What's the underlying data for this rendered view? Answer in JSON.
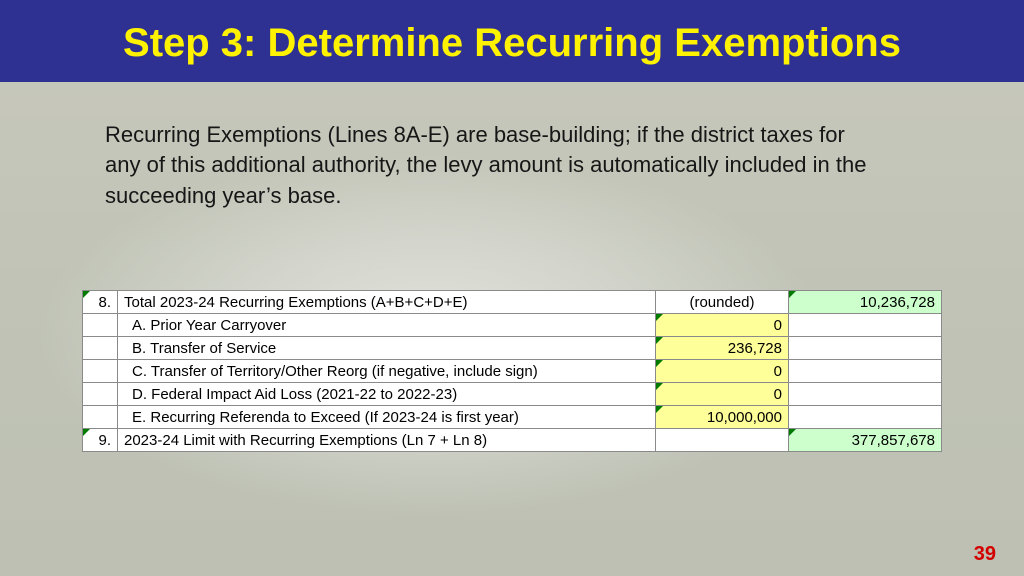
{
  "title": "Step 3: Determine Recurring Exemptions",
  "body": "Recurring Exemptions (Lines 8A-E) are base-building; if the district taxes for any of this additional authority, the levy amount is automatically included in the succeeding year’s base.",
  "page_number": "39",
  "table": {
    "rows": [
      {
        "lineno": "8.",
        "letter": "",
        "label": "Total 2023-24 Recurring Exemptions (A+B+C+D+E)",
        "col2": "(rounded)",
        "col3": "10,236,728",
        "col2_class": "rounded-note",
        "col3_class": "bg-green mark-tl"
      },
      {
        "lineno": "",
        "letter": "A.",
        "label": "Prior Year Carryover",
        "col2": "0",
        "col3": "",
        "col2_class": "bg-yellow mark-tl",
        "col3_class": ""
      },
      {
        "lineno": "",
        "letter": "B.",
        "label": "Transfer of Service",
        "col2": "236,728",
        "col3": "",
        "col2_class": "bg-yellow mark-tl",
        "col3_class": ""
      },
      {
        "lineno": "",
        "letter": "C.",
        "label": "Transfer of Territory/Other Reorg (if negative, include sign)",
        "col2": "0",
        "col3": "",
        "col2_class": "bg-yellow mark-tl",
        "col3_class": ""
      },
      {
        "lineno": "",
        "letter": "D.",
        "label": "Federal Impact Aid Loss (2021-22 to 2022-23)",
        "col2": "0",
        "col3": "",
        "col2_class": "bg-yellow mark-tl",
        "col3_class": ""
      },
      {
        "lineno": "",
        "letter": "E.",
        "label": "Recurring Referenda to Exceed (If 2023-24 is first year)",
        "col2": "10,000,000",
        "col3": "",
        "col2_class": "bg-yellow mark-tl",
        "col3_class": ""
      },
      {
        "lineno": "9.",
        "letter": "",
        "label": "2023-24 Limit with Recurring Exemptions  (Ln 7 + Ln 8)",
        "col2": "",
        "col3": "377,857,678",
        "col2_class": "",
        "col3_class": "bg-green mark-tl"
      }
    ]
  }
}
